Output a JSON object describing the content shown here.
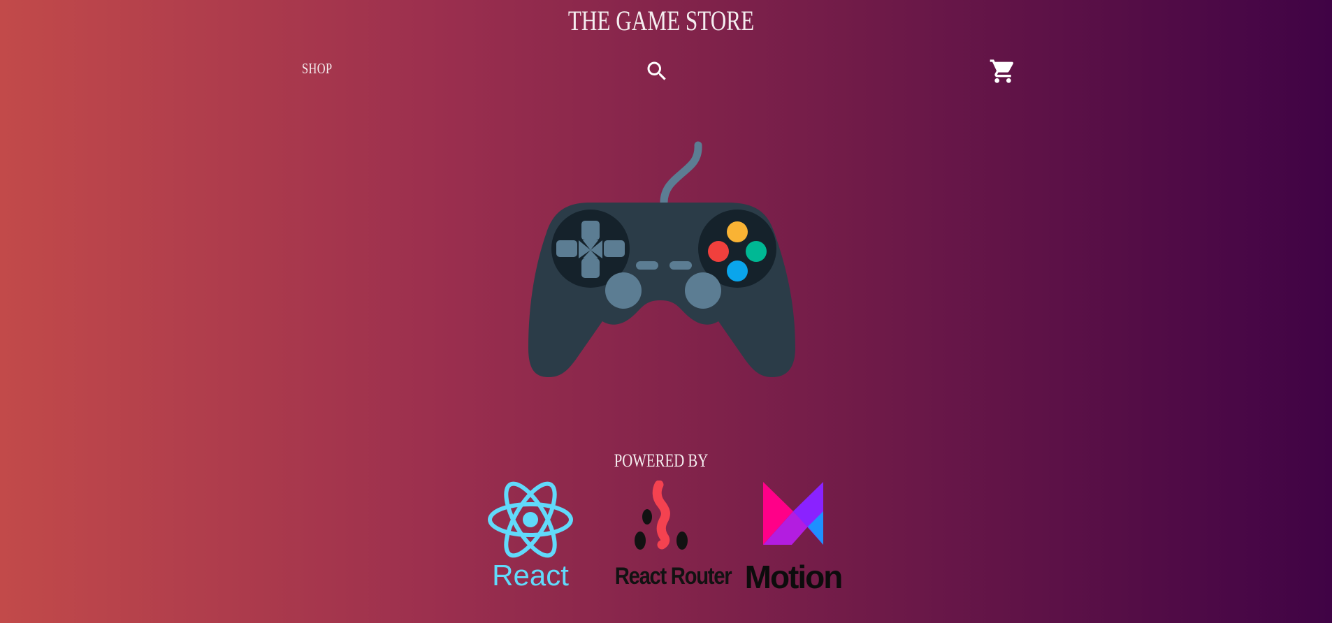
{
  "header": {
    "title": "THE GAME STORE"
  },
  "nav": {
    "shop_label": "SHOP",
    "search_icon": "search-icon",
    "cart_icon": "shopping-cart-icon"
  },
  "hero": {
    "image": "gamepad-controller-illustration"
  },
  "footer": {
    "powered_by": "POWERED BY",
    "logos": [
      {
        "name": "React",
        "icon": "react-logo",
        "color": "#61DAFB"
      },
      {
        "name": "React Router",
        "icon": "react-router-logo",
        "color": "#F44250"
      },
      {
        "name": "Motion",
        "icon": "motion-logo",
        "color": "#FF0088"
      }
    ]
  },
  "colors": {
    "gradient_start": "#C24A4A",
    "gradient_end": "#400345",
    "controller_body": "#2B3C48",
    "controller_accent": "#5C7D93",
    "button_yellow": "#F9B334",
    "button_red": "#F0403D",
    "button_green": "#00B894",
    "button_blue": "#0AA5EC"
  }
}
